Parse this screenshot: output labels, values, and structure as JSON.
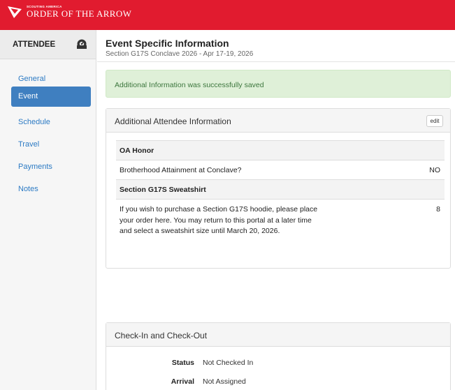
{
  "header": {
    "logo_small": "SCOUTING AMERICA",
    "logo_big": "ORDER OF THE ARROW",
    "logo_icon": "arrowhead-logo-icon",
    "brand_color": "#e11b2f"
  },
  "sidebar": {
    "title": "ATTENDEE",
    "title_icon": "dashboard-gauge-icon",
    "items": [
      {
        "label": "General",
        "active": false
      },
      {
        "label": "Event",
        "active": true
      },
      {
        "label": "Schedule",
        "active": false
      },
      {
        "label": "Travel",
        "active": false
      },
      {
        "label": "Payments",
        "active": false
      },
      {
        "label": "Notes",
        "active": false
      }
    ],
    "active_color": "#3f7fc0",
    "link_color": "#2d7bc4"
  },
  "main": {
    "title": "Event Specific Information",
    "subtitle": "Section G17S Conclave 2026 - Apr 17-19, 2026",
    "alert": "Additional Information was successfully saved",
    "alert_color": "#dff0d8"
  },
  "additional_panel": {
    "title": "Additional Attendee Information",
    "edit_label": "edit",
    "sections": [
      {
        "heading": "OA Honor",
        "question": "Brotherhood Attainment at Conclave?",
        "answer": "NO"
      },
      {
        "heading": "Section G17S Sweatshirt",
        "question": "If you wish to purchase a Section G17S hoodie, please place your order here. You may return to this portal at a later time and select a sweatshirt size until March 20, 2026.",
        "answer": "8"
      }
    ]
  },
  "checkin_panel": {
    "title": "Check-In and Check-Out",
    "fields": [
      {
        "label": "Status",
        "value": "Not Checked In"
      },
      {
        "label": "Arrival",
        "value": "Not Assigned"
      }
    ]
  }
}
